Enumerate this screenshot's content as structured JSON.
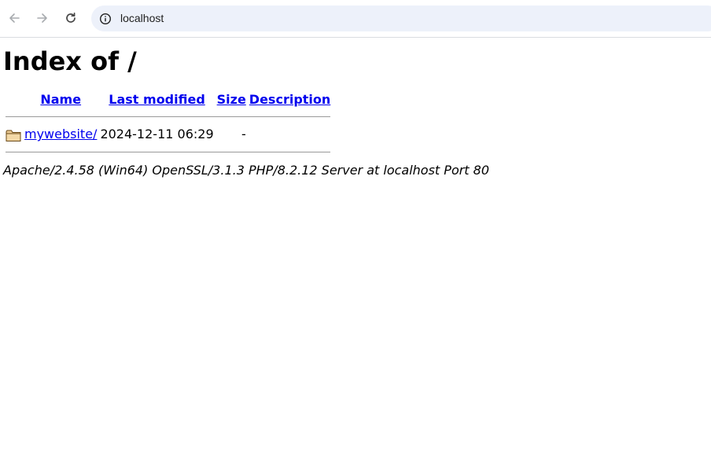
{
  "browser": {
    "url": "localhost"
  },
  "page": {
    "title": "Index of /",
    "columns": {
      "name": "Name",
      "last_modified": "Last modified",
      "size": "Size",
      "description": "Description"
    },
    "rows": [
      {
        "icon": "folder-icon",
        "name": "mywebsite/",
        "last_modified": "2024-12-11 06:29",
        "size": "-",
        "description": ""
      }
    ],
    "footer": "Apache/2.4.58 (Win64) OpenSSL/3.1.3 PHP/8.2.12 Server at localhost Port 80"
  }
}
